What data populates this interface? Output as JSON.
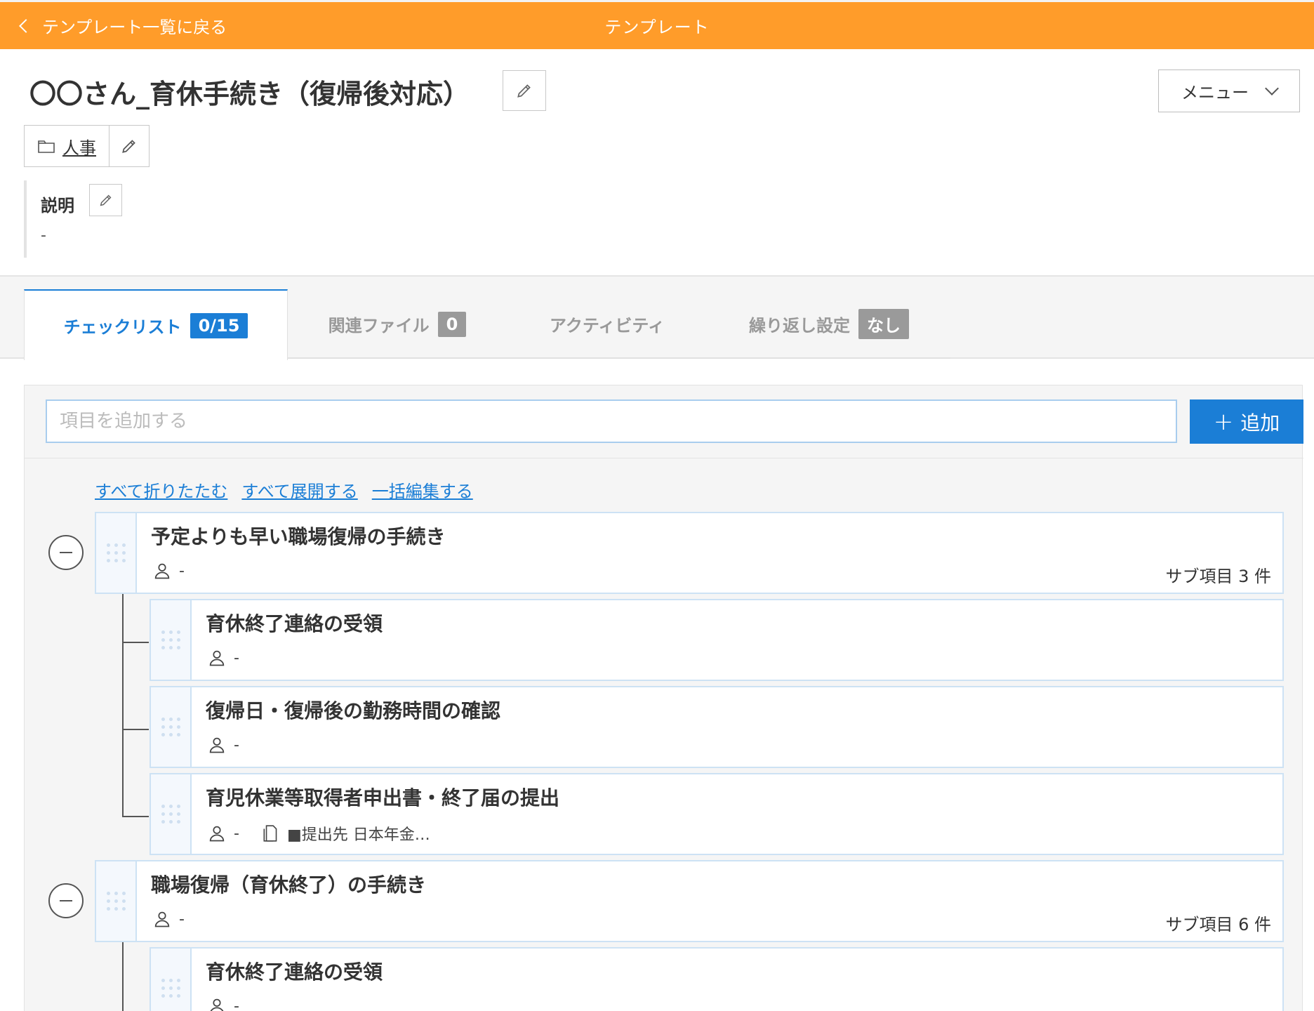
{
  "topbar": {
    "back_label": "テンプレート一覧に戻る",
    "title": "テンプレート",
    "color": "#ff9c2a"
  },
  "header": {
    "title": "〇〇さん_育休手続き（復帰後対応）",
    "menu_label": "メニュー",
    "category": "人事"
  },
  "description": {
    "label": "説明",
    "value": "-"
  },
  "tabs": [
    {
      "label": "チェックリスト",
      "badge": "0/15"
    },
    {
      "label": "関連ファイル",
      "badge": "0"
    },
    {
      "label": "アクティビティ",
      "badge": ""
    },
    {
      "label": "繰り返し設定",
      "badge": "なし"
    }
  ],
  "add": {
    "placeholder": "項目を追加する",
    "button_label": "追加"
  },
  "links": {
    "collapse_all": "すべて折りたたむ",
    "expand_all": "すべて展開する",
    "bulk_edit": "一括編集する"
  },
  "groups": [
    {
      "title": "予定よりも早い職場復帰の手続き",
      "assignee": "-",
      "count": "サブ項目 3 件",
      "children": [
        {
          "title": "育休終了連絡の受領",
          "assignee": "-"
        },
        {
          "title": "復帰日・復帰後の勤務時間の確認",
          "assignee": "-"
        },
        {
          "title": "育児休業等取得者申出書・終了届の提出",
          "assignee": "-",
          "note": "■提出先 日本年金…"
        }
      ]
    },
    {
      "title": "職場復帰（育休終了）の手続き",
      "assignee": "-",
      "count": "サブ項目 6 件",
      "children": [
        {
          "title": "育休終了連絡の受領",
          "assignee": "-"
        }
      ]
    }
  ],
  "colors": {
    "accent": "#1b7ed6",
    "item_border": "#cde2f4"
  }
}
